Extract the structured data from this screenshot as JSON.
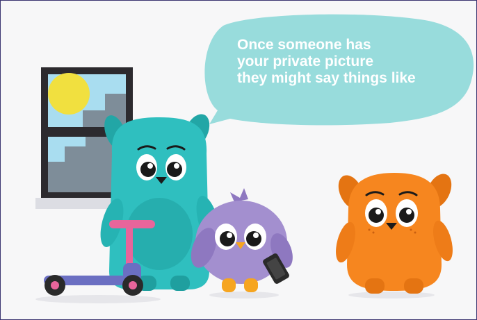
{
  "speech_bubble": {
    "lines": [
      "Once someone has",
      "your private picture",
      "they might say things like"
    ]
  },
  "colors": {
    "bubble": "#98dcdc",
    "teal_character": "#2fbfbf",
    "purple_character": "#a38fcf",
    "orange_character": "#f6861f",
    "scooter_handle": "#e8659b",
    "scooter_deck": "#6b6fc2",
    "frame_border": "#3a3470"
  }
}
